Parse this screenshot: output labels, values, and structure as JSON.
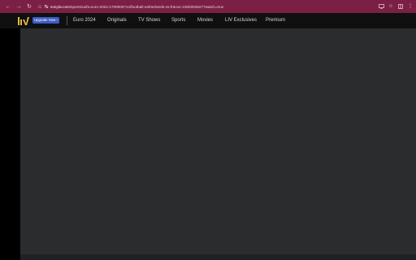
{
  "browser": {
    "url_host": "sonyliv.com",
    "url_path": "/sports/uefa-euro-2024-1700000714/football-netherlands-vs-france-1000283627?watch=true",
    "accent": "#7b1f45",
    "nav_icons": [
      "back-arrow-icon",
      "forward-arrow-icon",
      "reload-icon",
      "home-icon"
    ],
    "right_icons": [
      "cast-icon",
      "bookmark-star-icon",
      "extensions-icon",
      "menu-dots-icon"
    ]
  },
  "site": {
    "upgrade_label": "Upgrade Now ›",
    "nav": [
      "Euro 2024",
      "Originals",
      "TV Shows",
      "Sports",
      "Movies",
      "LIV Exclusives",
      "Premium"
    ],
    "upgrade_color": "#3b5cc4",
    "header_bg": "#101010",
    "player_bg": "#2b2c2e"
  }
}
